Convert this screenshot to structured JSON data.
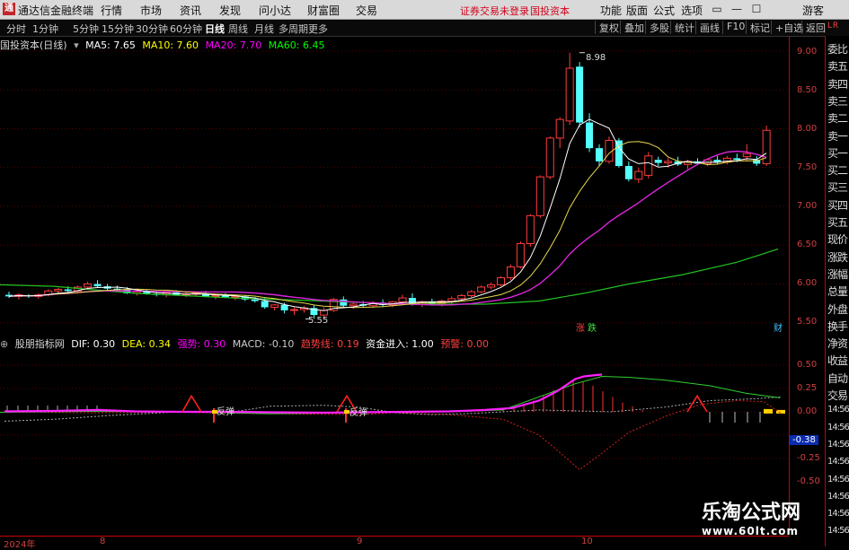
{
  "app": {
    "title": "通达信金融终端",
    "logo_text": "通",
    "menu": [
      "行情",
      "市场",
      "资讯",
      "发现",
      "问小达",
      "财富圈",
      "交易"
    ],
    "notice": "证券交易未登录",
    "stock_name_top": "国投资本",
    "right_menu": [
      "功能",
      "版面",
      "公式",
      "选项"
    ],
    "user": "游客",
    "window_buttons": [
      "▭",
      "—",
      "☐",
      "✕"
    ]
  },
  "period_bar": {
    "periods": [
      "分时",
      "1分钟",
      "5分钟",
      "15分钟",
      "30分钟",
      "60分钟",
      "日线",
      "周线",
      "月线",
      "多周期",
      "更多"
    ],
    "selected": "日线",
    "tools": [
      "复权",
      "叠加",
      "多股",
      "统计",
      "画线",
      "F10",
      "标记",
      "+自选",
      "返回"
    ]
  },
  "main_chart": {
    "title": "国投资本(日线)",
    "ma": [
      {
        "label": "MA5: 7.65",
        "color": "#ffffff"
      },
      {
        "label": "MA10: 7.60",
        "color": "#ffff00"
      },
      {
        "label": "MA20: 7.70",
        "color": "#ff00ff"
      },
      {
        "label": "MA60: 6.45",
        "color": "#00ff00"
      }
    ],
    "y_ticks": [
      "9.00",
      "8.50",
      "8.00",
      "7.50",
      "7.00",
      "6.50",
      "6.00",
      "5.50"
    ],
    "high_label": "8.98",
    "low_label": "5.55",
    "badges": [
      "涨",
      "跌",
      "财"
    ]
  },
  "indicator": {
    "title": "股朋指标网",
    "items": [
      {
        "label": "DIF: 0.30",
        "color": "#ffffff"
      },
      {
        "label": "DEA: 0.34",
        "color": "#ffff00"
      },
      {
        "label": "强势: 0.30",
        "color": "#ff00ff"
      },
      {
        "label": "MACD: -0.10",
        "color": "#cccccc"
      },
      {
        "label": "趋势线: 0.19",
        "color": "#ff4040"
      },
      {
        "label": "资金进入: 1.00",
        "color": "#ffffff"
      },
      {
        "label": "预警: 0.00",
        "color": "#ff4040"
      }
    ],
    "y_ticks": [
      "0.50",
      "0.25",
      "0.00",
      "-0.25",
      "-0.50"
    ],
    "current_value": "-0.38",
    "signal_labels": [
      "反弹",
      "反弹"
    ]
  },
  "right_panel": {
    "corner": "L R",
    "items": [
      "委比",
      "卖五",
      "卖四",
      "卖三",
      "卖二",
      "卖一",
      "买一",
      "买二",
      "买三",
      "买四",
      "买五",
      "现价",
      "涨跌",
      "涨幅",
      "总量",
      "外盘",
      "换手",
      "净资",
      "收益",
      "自动",
      "交易",
      "14:56",
      "14:56",
      "14:56",
      "14:56",
      "14:56",
      "14:56",
      "14:56",
      "14:56"
    ]
  },
  "x_axis": {
    "labels": [
      "2024年",
      "8",
      "9",
      "10"
    ]
  },
  "watermark": {
    "title": "乐淘公式网",
    "url": "www.60lt.com"
  }
}
